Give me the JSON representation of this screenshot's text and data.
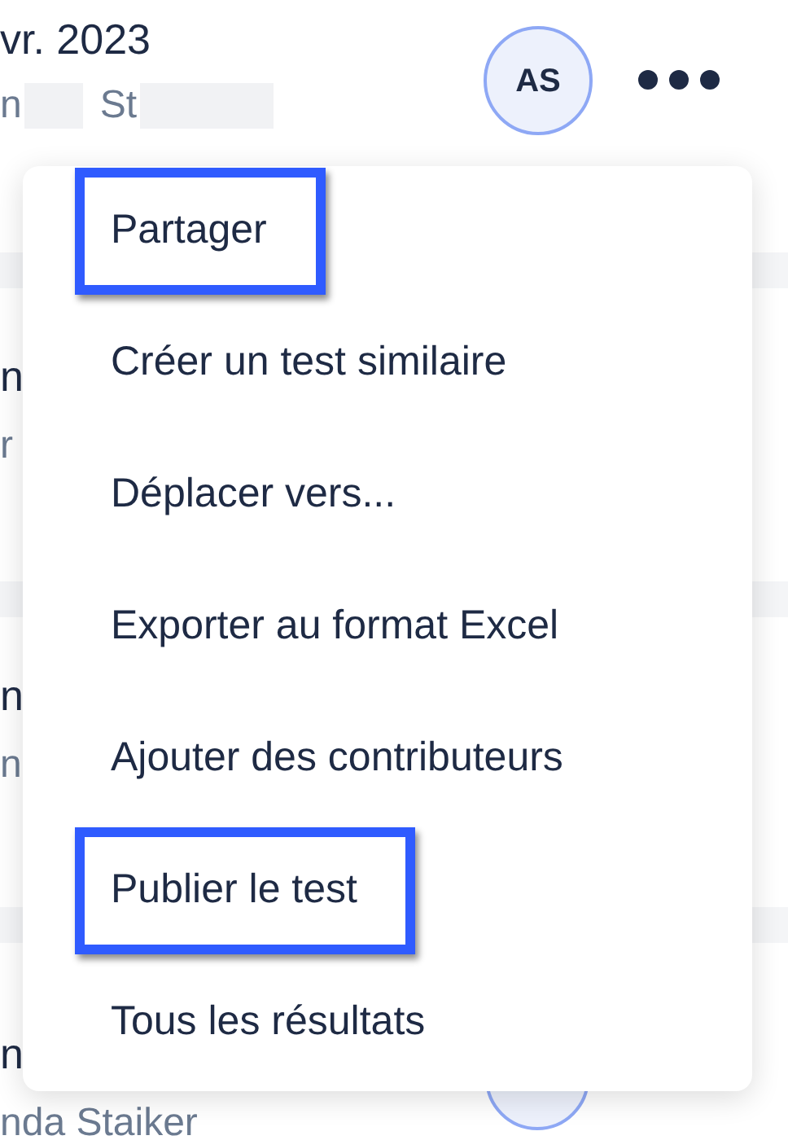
{
  "header_row": {
    "date": "vr. 2023",
    "author_parts": [
      "n",
      "St"
    ],
    "avatar": "AS"
  },
  "rows": [
    {
      "title": "n",
      "author": "r"
    },
    {
      "title": "n",
      "author": "n"
    },
    {
      "title": "n",
      "author": "nda Staiker"
    }
  ],
  "menu": {
    "items": [
      {
        "label": "Partager",
        "highlighted": true
      },
      {
        "label": "Créer un test similaire",
        "highlighted": false
      },
      {
        "label": "Déplacer vers...",
        "highlighted": false
      },
      {
        "label": "Exporter au format Excel",
        "highlighted": false
      },
      {
        "label": "Ajouter des contributeurs",
        "highlighted": false
      },
      {
        "label": "Publier le test",
        "highlighted": true
      },
      {
        "label": "Tous les résultats",
        "highlighted": false
      }
    ]
  }
}
